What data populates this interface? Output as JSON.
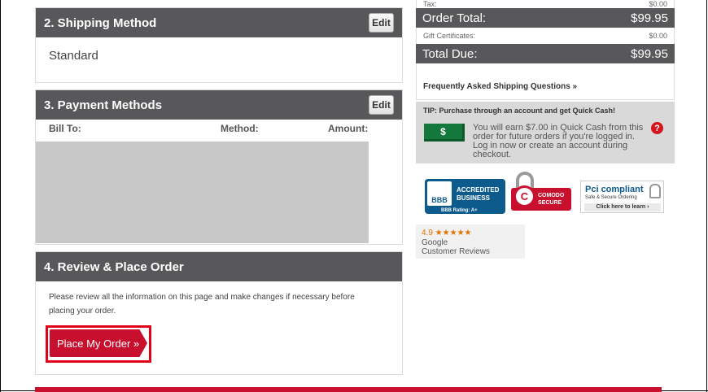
{
  "shipping": {
    "header": "2. Shipping Method",
    "edit_label": "Edit",
    "value": "Standard"
  },
  "payment": {
    "header": "3. Payment Methods",
    "edit_label": "Edit",
    "col_bill_to": "Bill To:",
    "col_method": "Method:",
    "col_amount": "Amount:"
  },
  "review": {
    "header": "4. Review & Place Order",
    "text": "Please review all the information on this page and make changes if necessary before placing your order.",
    "button_label": "Place My Order »"
  },
  "summary": {
    "tax_label": "Tax:",
    "tax_value": "$0.00",
    "order_total_label": "Order Total:",
    "order_total_value": "$99.95",
    "gift_label": "Gift Certificates:",
    "gift_value": "$0.00",
    "total_due_label": "Total Due:",
    "total_due_value": "$99.95",
    "faq_link": "Frequently Asked Shipping Questions »"
  },
  "tip": {
    "title": "TIP: Purchase through an account and get Quick Cash!",
    "cash_symbol": "$",
    "text": "You will earn $7.00 in Quick Cash from this order for future orders if you're logged in. Log in now or create an account during checkout.",
    "help_symbol": "?"
  },
  "badges": {
    "bbb_logo": "BBB",
    "bbb_line1": "ACCREDITED",
    "bbb_line2": "BUSINESS",
    "bbb_rating": "BBB Rating: A+",
    "comodo_letter": "C",
    "comodo_line1": "COMODO",
    "comodo_line2": "SECURE",
    "pci_title": "Pci compliant",
    "pci_sub": "Safe & Secure Ordering",
    "pci_link": "Click here to learn ›"
  },
  "google": {
    "rating": "4.9 ★★★★★",
    "name": "Google",
    "label": "Customer Reviews"
  },
  "colors": {
    "header_bg": "#58585a",
    "accent_red": "#c8102e",
    "cash_green": "#14783c"
  }
}
